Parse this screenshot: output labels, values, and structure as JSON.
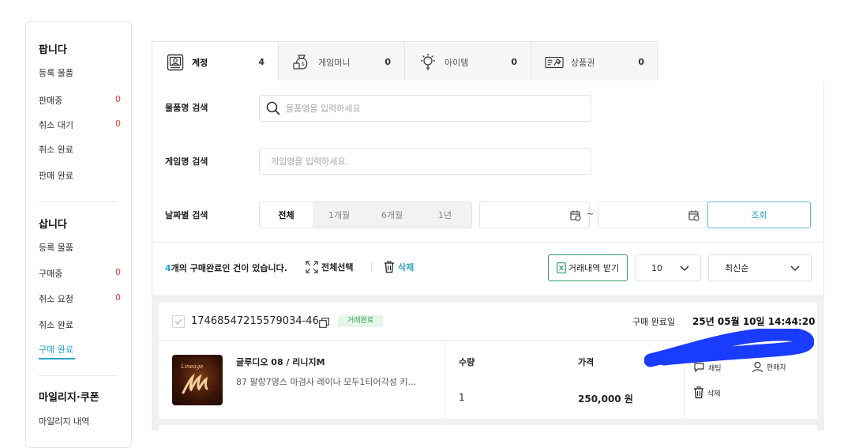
{
  "sidebar": {
    "sell": {
      "title": "팝니다",
      "items": [
        {
          "label": "등록 물품",
          "count": ""
        },
        {
          "label": "판매중",
          "count": "0"
        },
        {
          "label": "취소 대기",
          "count": "0"
        },
        {
          "label": "취소 완료",
          "count": ""
        },
        {
          "label": "판매 완료",
          "count": ""
        }
      ]
    },
    "buy": {
      "title": "삽니다",
      "items": [
        {
          "label": "등록 물품",
          "count": ""
        },
        {
          "label": "구매중",
          "count": "0"
        },
        {
          "label": "취소 요청",
          "count": "0"
        },
        {
          "label": "취소 완료",
          "count": ""
        },
        {
          "label": "구매 완료",
          "count": ""
        }
      ]
    },
    "mileage": {
      "title": "마일리지·쿠폰",
      "items": [
        {
          "label": "마일리지 내역"
        }
      ]
    }
  },
  "tabs": [
    {
      "label": "계정",
      "count": "4",
      "icon": "account-icon"
    },
    {
      "label": "게임머니",
      "count": "0",
      "icon": "money-bag-icon"
    },
    {
      "label": "아이템",
      "count": "0",
      "icon": "item-icon"
    },
    {
      "label": "상품권",
      "count": "0",
      "icon": "gift-card-icon"
    }
  ],
  "filters": {
    "product": {
      "label": "물품명 검색",
      "placeholder": "물품명을 입력하세요"
    },
    "game": {
      "label": "게임명 검색",
      "placeholder": "게임명을 입력하세요."
    },
    "date": {
      "label": "날짜별 검색",
      "periods": [
        "전체",
        "1개월",
        "6개월",
        "1년"
      ],
      "tilde": "~",
      "search_label": "조회"
    }
  },
  "results": {
    "count": "4",
    "text": "개의 구매완료인 건이 있습니다.",
    "select_all": "전체선택",
    "delete": "삭제",
    "download": "거래내역 받기",
    "page_size": "10",
    "sort": "최신순"
  },
  "order": {
    "number": "17468547215579034-46",
    "status": "거래완료",
    "date_label": "구매 완료일",
    "date": "25년 05월 10일 14:44:20",
    "product_name": "글루디오 08 / 리니지M",
    "product_desc": "87 팔랑7영스 마검사 레이나 모두1티어각성 키…",
    "qty_label": "수량",
    "qty": "1",
    "price_label": "가격",
    "price": "250,000 원",
    "actions": {
      "chat": "채팅",
      "seller": "판매자",
      "delete": "삭제"
    }
  },
  "colors": {
    "accent": "#2aa3c8",
    "alert": "#e53935",
    "success": "#2f9e55",
    "redaction": "#1a3cff"
  }
}
